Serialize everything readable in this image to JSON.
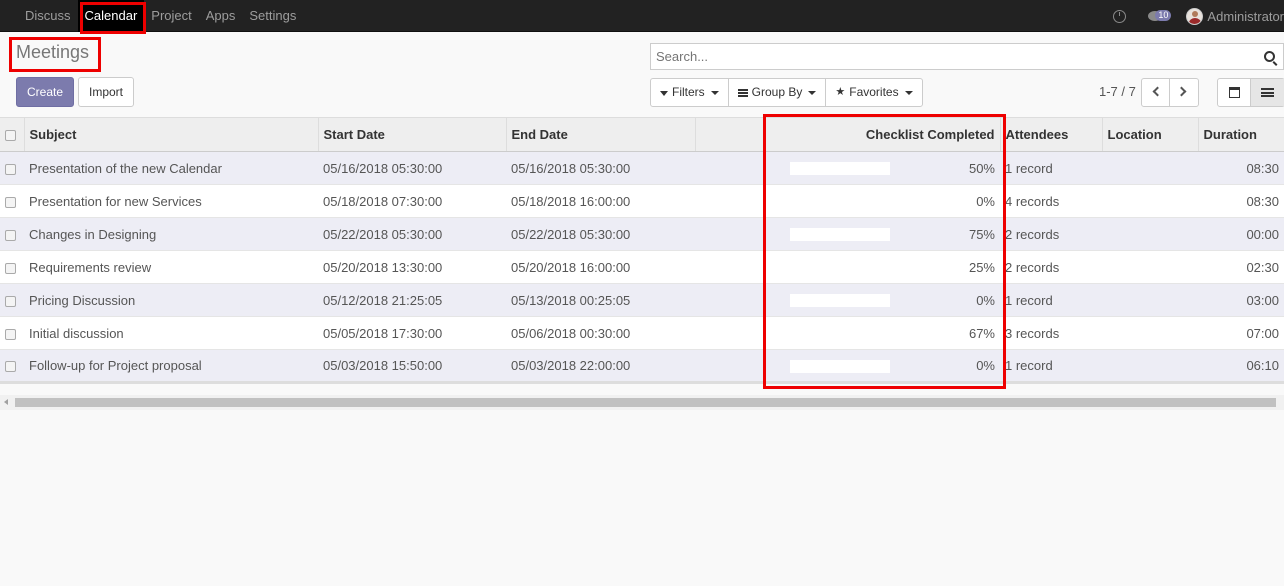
{
  "nav": {
    "menu": [
      "Discuss",
      "Calendar",
      "Project",
      "Apps",
      "Settings"
    ],
    "chat_count": "10",
    "user_name": "Administrator"
  },
  "page_title": "Meetings",
  "search": {
    "placeholder": "Search..."
  },
  "buttons": {
    "create": "Create",
    "import": "Import"
  },
  "filters": {
    "filters": "Filters",
    "group_by": "Group By",
    "favorites": "Favorites"
  },
  "pager": {
    "value": "1-7 / 7"
  },
  "accent_color": "#7c7bad",
  "table": {
    "columns": [
      "Subject",
      "Start Date",
      "End Date",
      "",
      "Checklist Completed",
      "Attendees",
      "Location",
      "Duration"
    ],
    "rows": [
      {
        "subject": "Presentation of the new Calendar",
        "start": "05/16/2018 05:30:00",
        "end": "05/16/2018 05:30:00",
        "progress": 50,
        "pct": "50%",
        "attendees": "1 record",
        "location": "",
        "duration": "08:30"
      },
      {
        "subject": "Presentation for new Services",
        "start": "05/18/2018 07:30:00",
        "end": "05/18/2018 16:00:00",
        "progress": null,
        "pct": "0%",
        "attendees": "4 records",
        "location": "",
        "duration": "08:30"
      },
      {
        "subject": "Changes in Designing",
        "start": "05/22/2018 05:30:00",
        "end": "05/22/2018 05:30:00",
        "progress": 75,
        "pct": "75%",
        "attendees": "2 records",
        "location": "",
        "duration": "00:00"
      },
      {
        "subject": "Requirements review",
        "start": "05/20/2018 13:30:00",
        "end": "05/20/2018 16:00:00",
        "progress": 25,
        "pct": "25%",
        "attendees": "2 records",
        "location": "",
        "duration": "02:30"
      },
      {
        "subject": "Pricing Discussion",
        "start": "05/12/2018 21:25:05",
        "end": "05/13/2018 00:25:05",
        "progress": 0,
        "pct": "0%",
        "attendees": "1 record",
        "location": "",
        "duration": "03:00"
      },
      {
        "subject": "Initial discussion",
        "start": "05/05/2018 17:30:00",
        "end": "05/06/2018 00:30:00",
        "progress": 67,
        "pct": "67%",
        "attendees": "3 records",
        "location": "",
        "duration": "07:00"
      },
      {
        "subject": "Follow-up for Project proposal",
        "start": "05/03/2018 15:50:00",
        "end": "05/03/2018 22:00:00",
        "progress": 0,
        "pct": "0%",
        "attendees": "1 record",
        "location": "",
        "duration": "06:10"
      }
    ]
  }
}
